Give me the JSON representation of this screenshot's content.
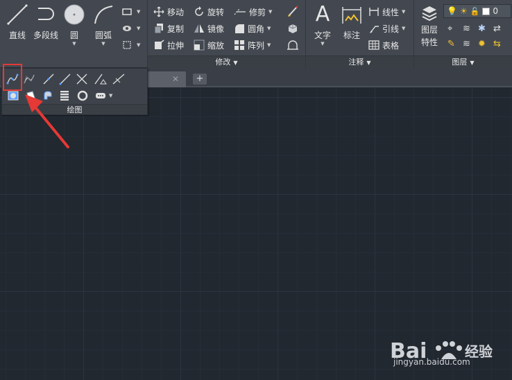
{
  "ribbon": {
    "draw": {
      "line": "直线",
      "polyline": "多段线",
      "circle": "圆",
      "arc": "圆弧"
    },
    "modify": {
      "title": "修改",
      "move": "移动",
      "rotate": "旋转",
      "trim": "修剪",
      "copy": "复制",
      "mirror": "镜像",
      "fillet": "圆角",
      "stretch": "拉伸",
      "scale": "缩放",
      "array": "阵列"
    },
    "annotation": {
      "title": "注释",
      "text": "文字",
      "dimension": "标注",
      "linear": "线性",
      "leader": "引线",
      "table": "表格"
    },
    "layers": {
      "title": "图层",
      "properties_line1": "图层",
      "properties_line2": "特性",
      "current_layer": "0"
    }
  },
  "flyout": {
    "title": "绘图"
  },
  "tabs": {
    "close_glyph": "✕",
    "new_glyph": "+"
  },
  "watermark": {
    "brand": "Bai",
    "brand2": "经验",
    "url": "jingyan.baidu.com"
  },
  "colors": {
    "ribbon_bg": "#434850",
    "canvas_bg": "#212830",
    "highlight": "#e53935",
    "accent_yellow": "#f2c231"
  }
}
